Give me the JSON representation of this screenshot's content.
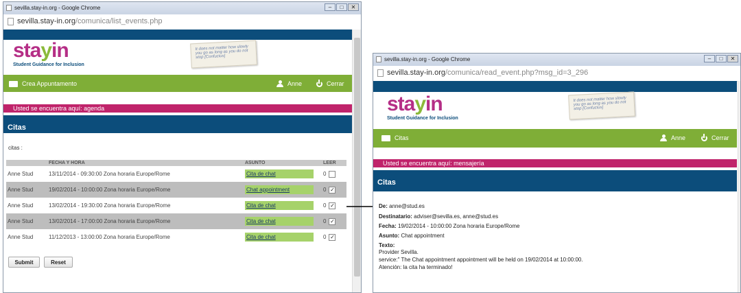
{
  "win1": {
    "title": "sevilla.stay-in.org - Google Chrome",
    "url_host": "sevilla.stay-in.org",
    "url_path": "/comunica/list_events.php",
    "logo": {
      "word_a": "sta",
      "word_b": "y",
      "word_c": "in",
      "tagline": "Student Guidance for Inclusion"
    },
    "note_text": "It does not matter how slowly you go as long as you do not stop [Confucius]",
    "menu": {
      "create": "Crea Appuntamento",
      "user": "Anne",
      "logout": "Cerrar"
    },
    "breadcrumb": "Usted se encuentra aquí: agenda",
    "section_title": "Citas",
    "list_label": "citas :",
    "table": {
      "headers": [
        "",
        "FECHA Y HORA",
        "ASUNTO",
        "LEER"
      ],
      "rows": [
        {
          "from": "Anne Stud",
          "date": "13/11/2014 - 09:30:00 Zona horaria Europe/Rome",
          "subject": "Cita de chat",
          "count": "0",
          "checked": false
        },
        {
          "from": "Anne Stud",
          "date": "19/02/2014 - 10:00:00 Zona horaria Europe/Rome",
          "subject": "Chat appointment",
          "count": "0",
          "checked": true
        },
        {
          "from": "Anne Stud",
          "date": "13/02/2014 - 19:30:00 Zona horaria Europe/Rome",
          "subject": "Cita de chat",
          "count": "0",
          "checked": true
        },
        {
          "from": "Anne Stud",
          "date": "13/02/2014 - 17:00:00 Zona horaria Europe/Rome",
          "subject": "Cita de chat",
          "count": "0",
          "checked": true
        },
        {
          "from": "Anne Stud",
          "date": "11/12/2013 - 13:00:00 Zona horaria Europe/Rome",
          "subject": "Cita de chat",
          "count": "0",
          "checked": true
        }
      ]
    },
    "submit_label": "Submit",
    "reset_label": "Reset"
  },
  "win2": {
    "title": "sevilla.stay-in.org - Google Chrome",
    "url_host": "sevilla.stay-in.org",
    "url_path": "/comunica/read_event.php?msg_id=3_296",
    "logo": {
      "word_a": "sta",
      "word_b": "y",
      "word_c": "in",
      "tagline": "Student Guidance for Inclusion"
    },
    "note_text": "It does not matter how slowly you go as long as you do not stop [Confucius]",
    "menu": {
      "citas": "Citas",
      "user": "Anne",
      "logout": "Cerrar"
    },
    "breadcrumb": "Usted se encuentra aquí: mensajería",
    "section_title": "Citas",
    "from_label": "De:",
    "from_value": "anne@stud.es",
    "to_label": "Destinatario:",
    "to_value": "adviser@sevilla.es, anne@stud.es",
    "date_label": "Fecha:",
    "date_value": "19/02/2014 - 10:00:00 Zona horaria Europe/Rome",
    "subject_label": "Asunto:",
    "subject_value": "Chat appointment",
    "text_label": "Texto:",
    "text_lines": [
      "Provider Sevilla.",
      "service:\" The Chat appointment appointment will be held on 19/02/2014 at 10:00:00.",
      "Atención: la cita ha terminado!"
    ]
  },
  "colors": {
    "navy": "#0c4d7b",
    "green": "#7fae37",
    "magenta": "#c0246b",
    "chat_green": "#a6d26a"
  }
}
